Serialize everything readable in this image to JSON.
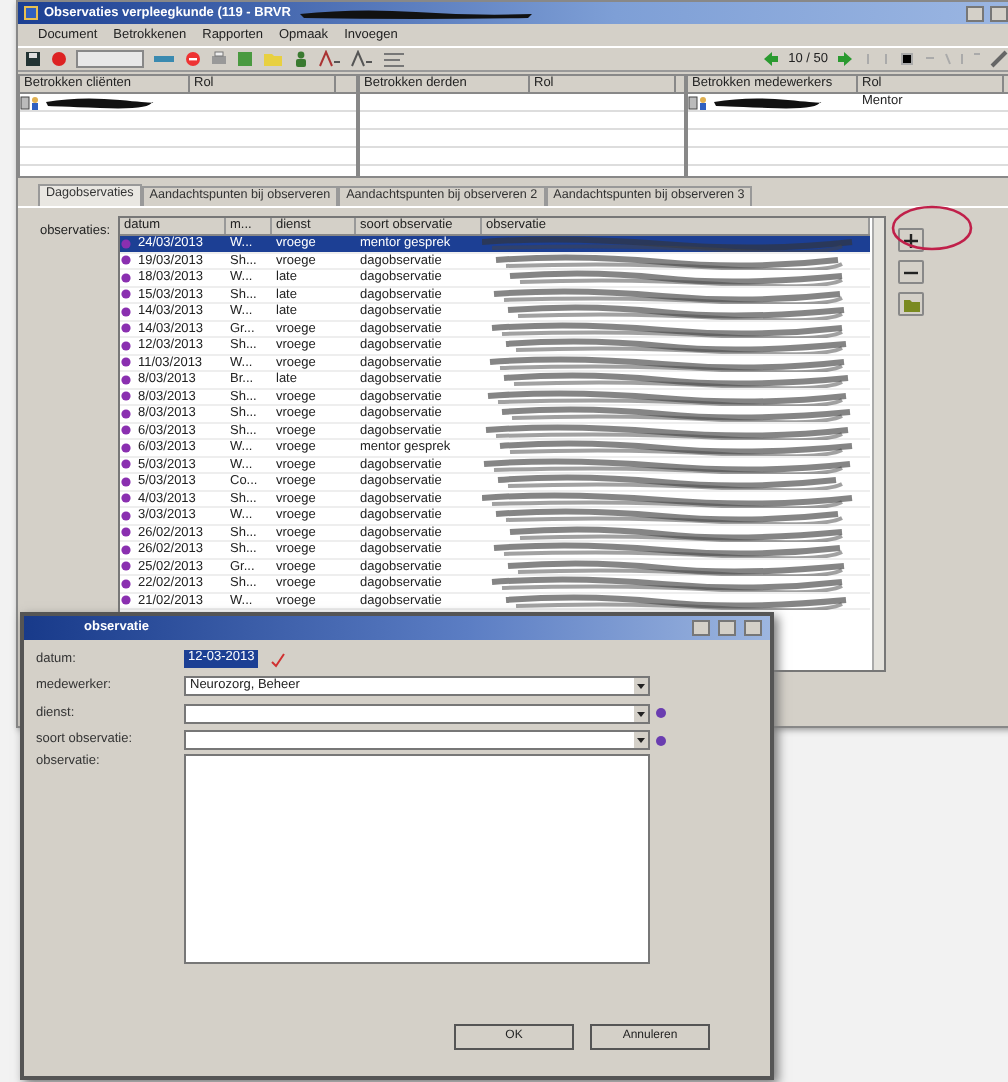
{
  "window": {
    "title": "Observaties verpleegkunde (119 - BRVR"
  },
  "menu": [
    "Document",
    "Betrokkenen",
    "Rapporten",
    "Opmaak",
    "Invoegen"
  ],
  "toolbar": {
    "counter": "10 / 50"
  },
  "panels": [
    {
      "columns": [
        "Betrokken cliënten",
        "Rol"
      ],
      "rows": [
        {
          "kind": "person"
        }
      ]
    },
    {
      "columns": [
        "Betrokken derden",
        "Rol"
      ]
    },
    {
      "columns": [
        "Betrokken medewerkers",
        "Rol"
      ],
      "rows": [
        {
          "kind": "person",
          "role": "Mentor"
        }
      ]
    }
  ],
  "tabs": [
    {
      "label": "Dagobservaties",
      "selected": true
    },
    {
      "label": "Aandachtspunten bij observeren",
      "selected": false
    },
    {
      "label": "Aandachtspunten bij observeren 2",
      "selected": false
    },
    {
      "label": "Aandachtspunten bij observeren 3",
      "selected": false
    }
  ],
  "observations": {
    "label": "observaties:",
    "columns": [
      "datum",
      "m...",
      "dienst",
      "soort observatie",
      "observatie"
    ],
    "rows": [
      {
        "datum": "24/03/2013",
        "medewerker": "W...",
        "dienst": "vroege",
        "soort": "mentor gesprek",
        "selected": true
      },
      {
        "datum": "19/03/2013",
        "medewerker": "Sh...",
        "dienst": "vroege",
        "soort": "dagobservatie",
        "selected": false
      },
      {
        "datum": "18/03/2013",
        "medewerker": "W...",
        "dienst": "late",
        "soort": "dagobservatie",
        "selected": false
      },
      {
        "datum": "15/03/2013",
        "medewerker": "Sh...",
        "dienst": "late",
        "soort": "dagobservatie",
        "selected": false
      },
      {
        "datum": "14/03/2013",
        "medewerker": "W...",
        "dienst": "late",
        "soort": "dagobservatie",
        "selected": false
      },
      {
        "datum": "14/03/2013",
        "medewerker": "Gr...",
        "dienst": "vroege",
        "soort": "dagobservatie",
        "selected": false
      },
      {
        "datum": "12/03/2013",
        "medewerker": "Sh...",
        "dienst": "vroege",
        "soort": "dagobservatie",
        "selected": false
      },
      {
        "datum": "11/03/2013",
        "medewerker": "W...",
        "dienst": "vroege",
        "soort": "dagobservatie",
        "selected": false
      },
      {
        "datum": "8/03/2013",
        "medewerker": "Br...",
        "dienst": "late",
        "soort": "dagobservatie",
        "selected": false
      },
      {
        "datum": "8/03/2013",
        "medewerker": "Sh...",
        "dienst": "vroege",
        "soort": "dagobservatie",
        "selected": false
      },
      {
        "datum": "8/03/2013",
        "medewerker": "Sh...",
        "dienst": "vroege",
        "soort": "dagobservatie",
        "selected": false
      },
      {
        "datum": "6/03/2013",
        "medewerker": "Sh...",
        "dienst": "vroege",
        "soort": "dagobservatie",
        "selected": false
      },
      {
        "datum": "6/03/2013",
        "medewerker": "W...",
        "dienst": "vroege",
        "soort": "mentor gesprek",
        "selected": false
      },
      {
        "datum": "5/03/2013",
        "medewerker": "W...",
        "dienst": "vroege",
        "soort": "dagobservatie",
        "selected": false
      },
      {
        "datum": "5/03/2013",
        "medewerker": "Co...",
        "dienst": "vroege",
        "soort": "dagobservatie",
        "selected": false
      },
      {
        "datum": "4/03/2013",
        "medewerker": "Sh...",
        "dienst": "vroege",
        "soort": "dagobservatie",
        "selected": false
      },
      {
        "datum": "3/03/2013",
        "medewerker": "W...",
        "dienst": "vroege",
        "soort": "dagobservatie",
        "selected": false
      },
      {
        "datum": "26/02/2013",
        "medewerker": "Sh...",
        "dienst": "vroege",
        "soort": "dagobservatie",
        "selected": false
      },
      {
        "datum": "26/02/2013",
        "medewerker": "Sh...",
        "dienst": "vroege",
        "soort": "dagobservatie",
        "selected": false
      },
      {
        "datum": "25/02/2013",
        "medewerker": "Gr...",
        "dienst": "vroege",
        "soort": "dagobservatie",
        "selected": false
      },
      {
        "datum": "22/02/2013",
        "medewerker": "Sh...",
        "dienst": "vroege",
        "soort": "dagobservatie",
        "selected": false
      },
      {
        "datum": "21/02/2013",
        "medewerker": "W...",
        "dienst": "vroege",
        "soort": "dagobservatie",
        "selected": false
      }
    ]
  },
  "dialog": {
    "title": "observatie",
    "fields": [
      {
        "label": "datum:",
        "kind": "date",
        "value": "12-03-2013"
      },
      {
        "label": "medewerker:",
        "kind": "combo",
        "value": "Neurozorg, Beheer",
        "required": false
      },
      {
        "label": "dienst:",
        "kind": "combo",
        "required": true
      },
      {
        "label": "soort observatie:",
        "kind": "combo",
        "required": true
      },
      {
        "label": "observatie:",
        "kind": "memo"
      }
    ],
    "buttons": [
      "OK",
      "Annuleren"
    ]
  }
}
